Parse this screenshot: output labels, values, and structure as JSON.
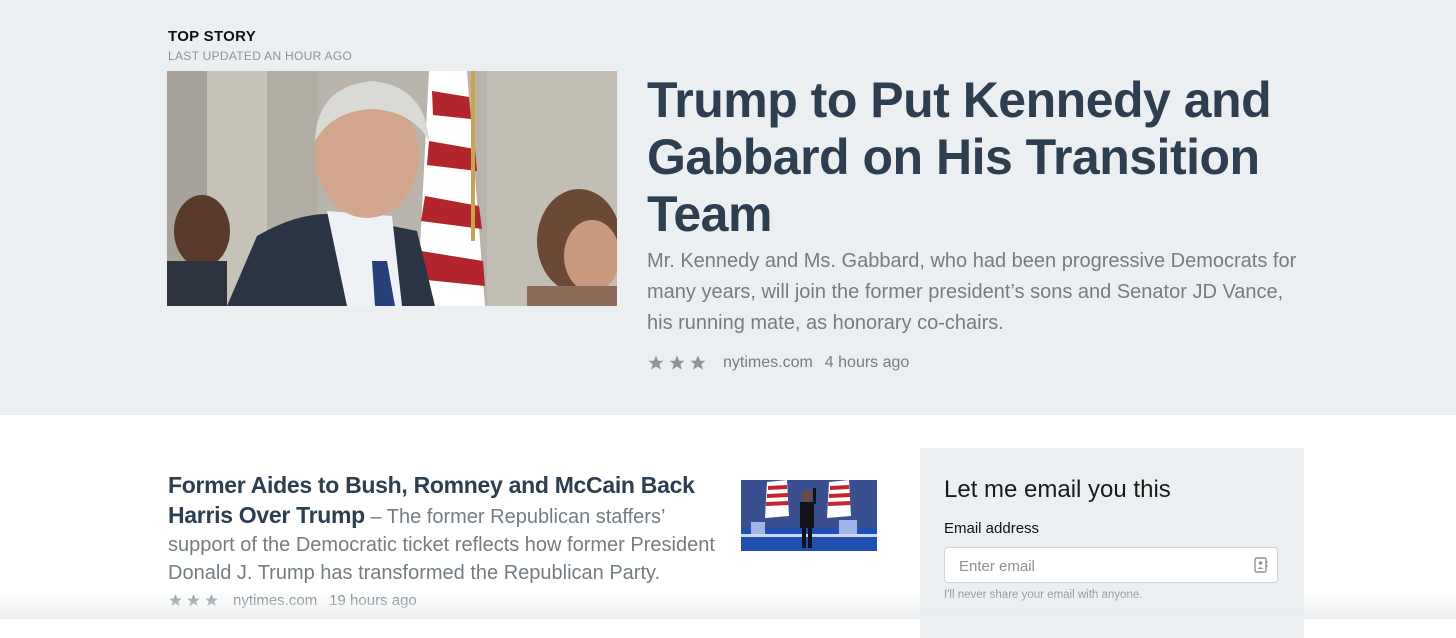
{
  "top_story": {
    "label": "TOP STORY",
    "updated": "LAST UPDATED AN HOUR AGO",
    "headline": "Trump to Put Kennedy and Gabbard on His Transition Team",
    "summary": "Mr. Kennedy and Ms. Gabbard, who had been progressive Democrats for many years, will join the former president’s sons and Senator JD Vance, his running mate, as honorary co-chairs.",
    "rating": 3,
    "source": "nytimes.com",
    "time": "4 hours ago"
  },
  "article": {
    "headline": "Former Aides to Bush, Romney and McCain Back Harris Over Trump",
    "separator": "–",
    "summary": "The former Republican staffers’ support of the Democratic ticket reflects how former President Donald J. Trump has transformed the Republican Party.",
    "rating": 3,
    "source": "nytimes.com",
    "time": "19 hours ago"
  },
  "email_form": {
    "title": "Let me email you this",
    "label": "Email address",
    "placeholder": "Enter email",
    "help": "I'll never share your email with anyone."
  },
  "colors": {
    "hero_bg": "#eceff1",
    "headline": "#2c3e50",
    "muted": "#737d84"
  }
}
